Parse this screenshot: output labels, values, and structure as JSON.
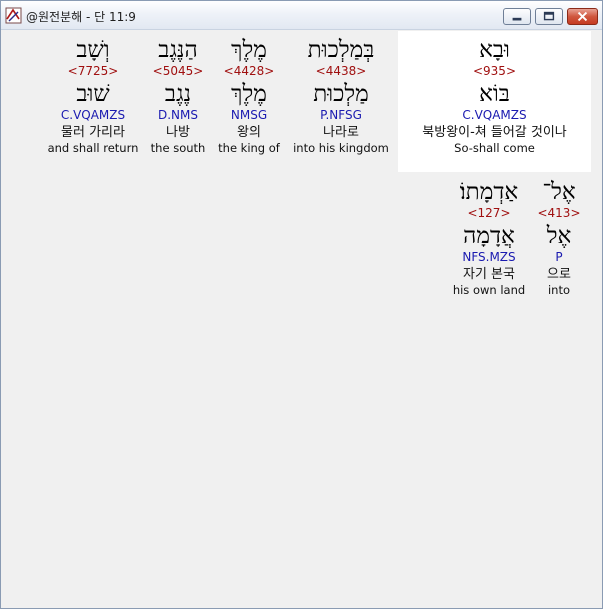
{
  "window": {
    "title": "@원전분해 - 단 11:9"
  },
  "words": [
    {
      "hebrew": "וּבָא",
      "strong": "<935>",
      "lemma": "בּוֹא",
      "parse": "C.VQAMZS",
      "korean": "북방왕이-쳐 들어갈 것이나",
      "english": "So-shall come",
      "selected": true
    },
    {
      "hebrew": "בְּמַלְכוּת",
      "strong": "<4438>",
      "lemma": "מַלְכוּת",
      "parse": "P.NFSG",
      "korean": "나라로",
      "english": "into his kingdom"
    },
    {
      "hebrew": "מֶלֶךְ",
      "strong": "<4428>",
      "lemma": "מֶלֶךְ",
      "parse": "NMSG",
      "korean": "왕의",
      "english": "the king of"
    },
    {
      "hebrew": "הַנֶּגֶב",
      "strong": "<5045>",
      "lemma": "נֶגֶב",
      "parse": "D.NMS",
      "korean": "나방",
      "english": "the south"
    },
    {
      "hebrew": "וְשָׁב",
      "strong": "<7725>",
      "lemma": "שׁוּב",
      "parse": "C.VQAMZS",
      "korean": "물러 가리라",
      "english": "and shall return"
    },
    {
      "hebrew": "אֶל־",
      "strong": "<413>",
      "lemma": "אֶל",
      "parse": "P",
      "korean": "으로",
      "english": "into"
    },
    {
      "hebrew": "אַדְמָתוֹ׃",
      "strong": "<127>",
      "lemma": "אֲדָמָה",
      "parse": "NFS.MZS",
      "korean": "자기 본국",
      "english": "his own land"
    }
  ]
}
